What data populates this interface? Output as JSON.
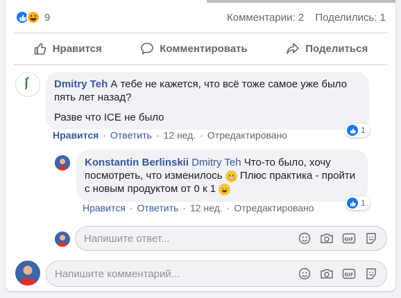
{
  "stats": {
    "reaction_count": "9",
    "comments": "Комментарии: 2",
    "shares": "Поделились: 1"
  },
  "actions": {
    "like": "Нравится",
    "comment": "Комментировать",
    "share": "Поделиться"
  },
  "comment1": {
    "author": "Dmitry Teh",
    "text_line1": "А тебе не кажется, что всё тоже самое уже было пять лет назад?",
    "text_line2": "Разве что ICE не было",
    "like": "Нравится",
    "reply": "Ответить",
    "time": "12 нед.",
    "edited": "Отредактировано",
    "reactions": "1"
  },
  "reply1": {
    "author": "Konstantin Berlinskii",
    "mention": "Dmitry Teh",
    "text_a": "Что-то было, хочу посмотреть, что изменилось",
    "text_b": "Плюс практика - пройти с новым продуктом от 0 к 1",
    "like": "Нравится",
    "reply": "Ответить",
    "time": "12 нед.",
    "edited": "Отредактировано",
    "reactions": "1"
  },
  "reply_input": {
    "placeholder": "Напишите ответ..."
  },
  "comment_input": {
    "placeholder": "Напишите комментарий..."
  },
  "colors": {
    "link": "#385898",
    "like_blue": "#1877f2",
    "bubble": "#f0f2f5"
  }
}
